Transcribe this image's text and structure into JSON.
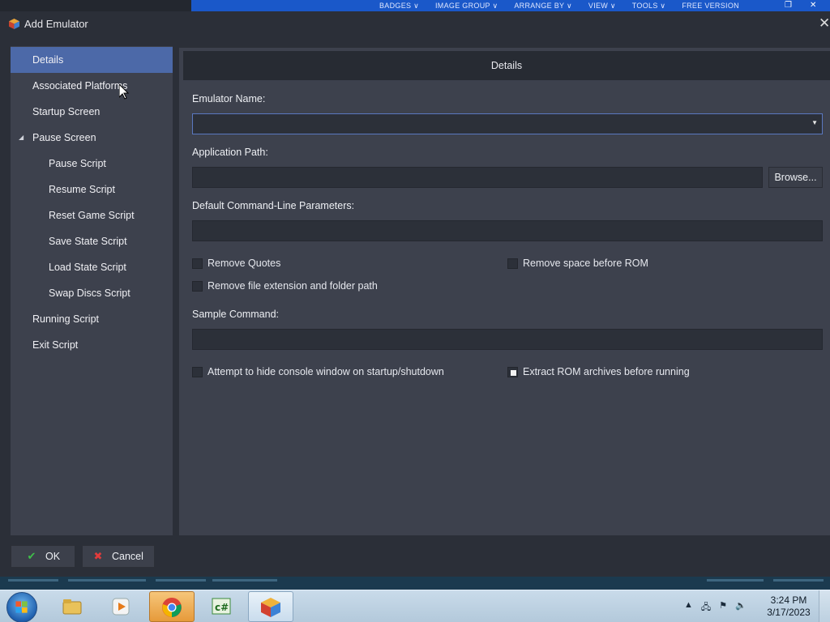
{
  "background_app": {
    "menu": [
      "BADGES ∨",
      "IMAGE GROUP ∨",
      "ARRANGE BY ∨",
      "VIEW ∨",
      "TOOLS ∨",
      "FREE VERSION"
    ]
  },
  "dialog": {
    "title": "Add Emulator",
    "close_label": "✕"
  },
  "sidebar": {
    "items": [
      {
        "label": "Details",
        "indent": 0,
        "selected": true
      },
      {
        "label": "Associated Platforms",
        "indent": 0
      },
      {
        "label": "Startup Screen",
        "indent": 0
      },
      {
        "label": "Pause Screen",
        "indent": 0,
        "expanded": true
      },
      {
        "label": "Pause Script",
        "indent": 1
      },
      {
        "label": "Resume Script",
        "indent": 1
      },
      {
        "label": "Reset Game Script",
        "indent": 1
      },
      {
        "label": "Save State Script",
        "indent": 1
      },
      {
        "label": "Load State Script",
        "indent": 1
      },
      {
        "label": "Swap Discs Script",
        "indent": 1
      },
      {
        "label": "Running Script",
        "indent": 0
      },
      {
        "label": "Exit Script",
        "indent": 0
      }
    ]
  },
  "details": {
    "header": "Details",
    "emulator_name_label": "Emulator Name:",
    "emulator_name_value": "",
    "application_path_label": "Application Path:",
    "application_path_value": "",
    "browse_label": "Browse...",
    "command_line_label": "Default Command-Line Parameters:",
    "command_line_value": "",
    "remove_quotes_label": "Remove Quotes",
    "remove_quotes_checked": false,
    "remove_space_label": "Remove space before ROM",
    "remove_space_checked": false,
    "remove_ext_label": "Remove file extension and folder path",
    "remove_ext_checked": false,
    "sample_command_label": "Sample Command:",
    "sample_command_value": "",
    "hide_console_label": "Attempt to hide console window on startup/shutdown",
    "hide_console_checked": false,
    "extract_rom_label": "Extract ROM archives before running",
    "extract_rom_checked": true
  },
  "footer": {
    "ok_label": "OK",
    "cancel_label": "Cancel"
  },
  "taskbar": {
    "time": "3:24 PM",
    "date": "3/17/2023",
    "apps": [
      "windows-explorer",
      "media-player",
      "chrome",
      "csharp-editor",
      "launchbox"
    ]
  },
  "colors": {
    "accent": "#4c69a8",
    "panel": "#3d414d",
    "dialog_bg": "#2b2f38",
    "input_bg": "#2c3039",
    "ok_icon": "#3fbf4a",
    "cancel_icon": "#e23b3b"
  }
}
